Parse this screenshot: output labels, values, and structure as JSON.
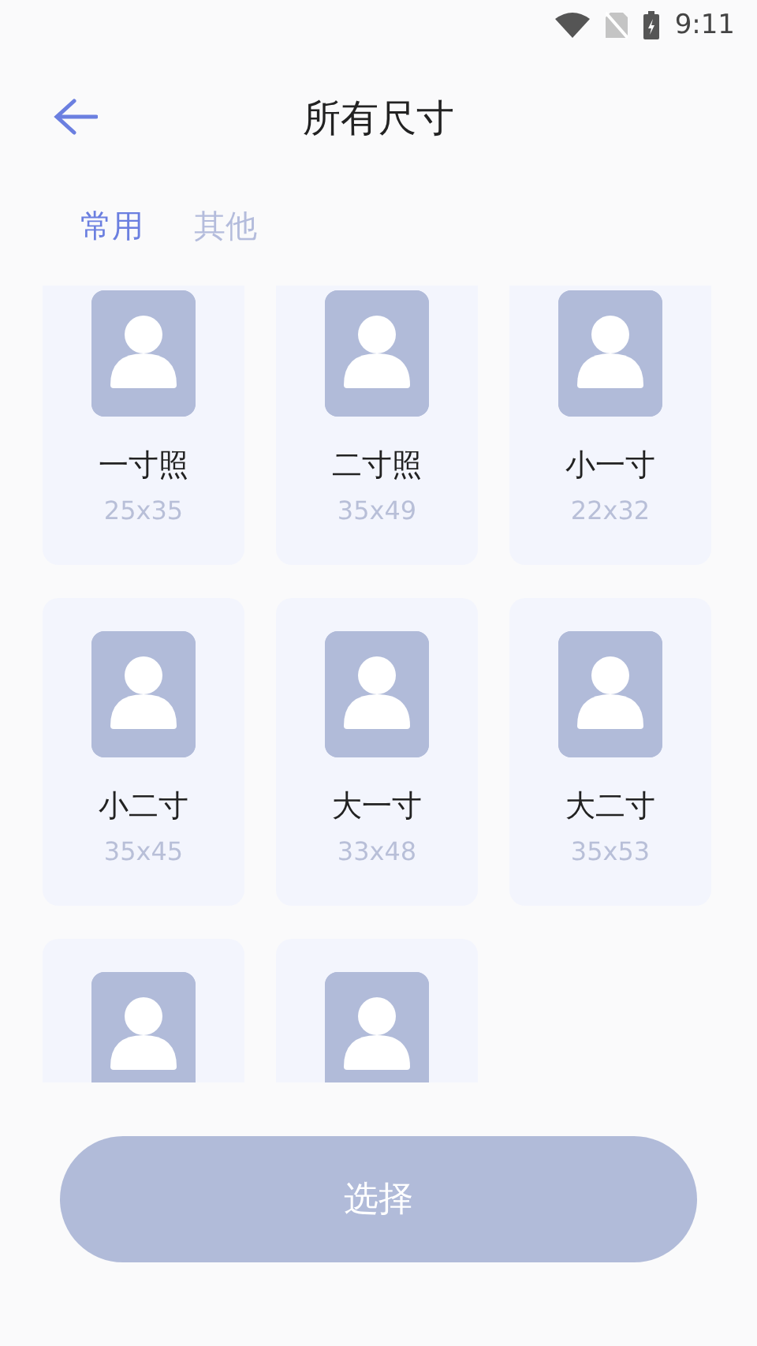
{
  "status_bar": {
    "time": "9:11"
  },
  "header": {
    "title": "所有尺寸"
  },
  "tabs": [
    {
      "label": "常用",
      "selected": true
    },
    {
      "label": "其他",
      "selected": false
    }
  ],
  "sizes": [
    {
      "kind": "full",
      "name": "一寸照",
      "size": "25x35"
    },
    {
      "kind": "full",
      "name": "二寸照",
      "size": "35x49"
    },
    {
      "kind": "full",
      "name": "小一寸",
      "size": "22x32"
    },
    {
      "kind": "full",
      "name": "小二寸",
      "size": "35x45"
    },
    {
      "kind": "full",
      "name": "大一寸",
      "size": "33x48"
    },
    {
      "kind": "full",
      "name": "大二寸",
      "size": "35x53"
    },
    {
      "kind": "cut"
    },
    {
      "kind": "cut"
    }
  ],
  "button": {
    "label": "选择"
  }
}
